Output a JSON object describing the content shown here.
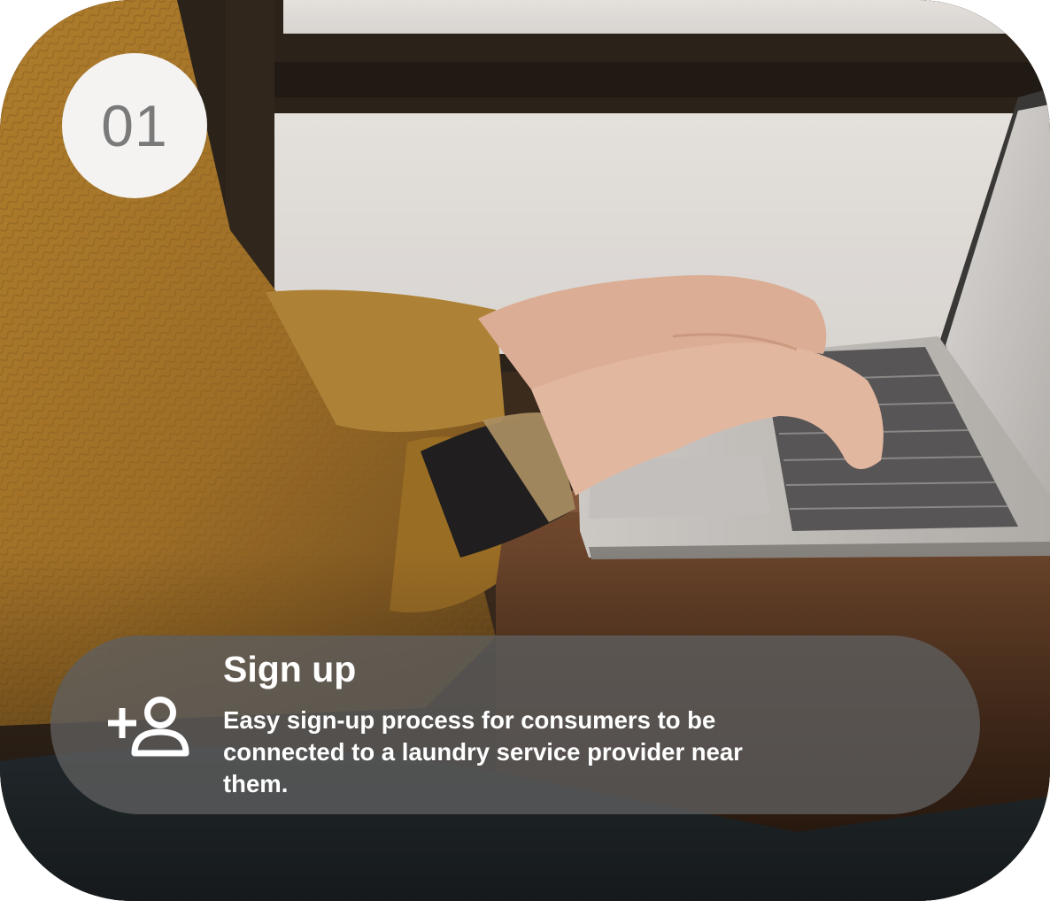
{
  "step": {
    "number": "01"
  },
  "feature": {
    "title": "Sign up",
    "description": "Easy sign-up process for consumers to be\nconnected to a  laundry service provider near\nthem.",
    "icon": "add-user-icon"
  },
  "colors": {
    "badge_background": "#f4f3f2",
    "badge_text": "#7a7a7a",
    "pill_background": "#5f5f5f",
    "text": "#ffffff"
  }
}
